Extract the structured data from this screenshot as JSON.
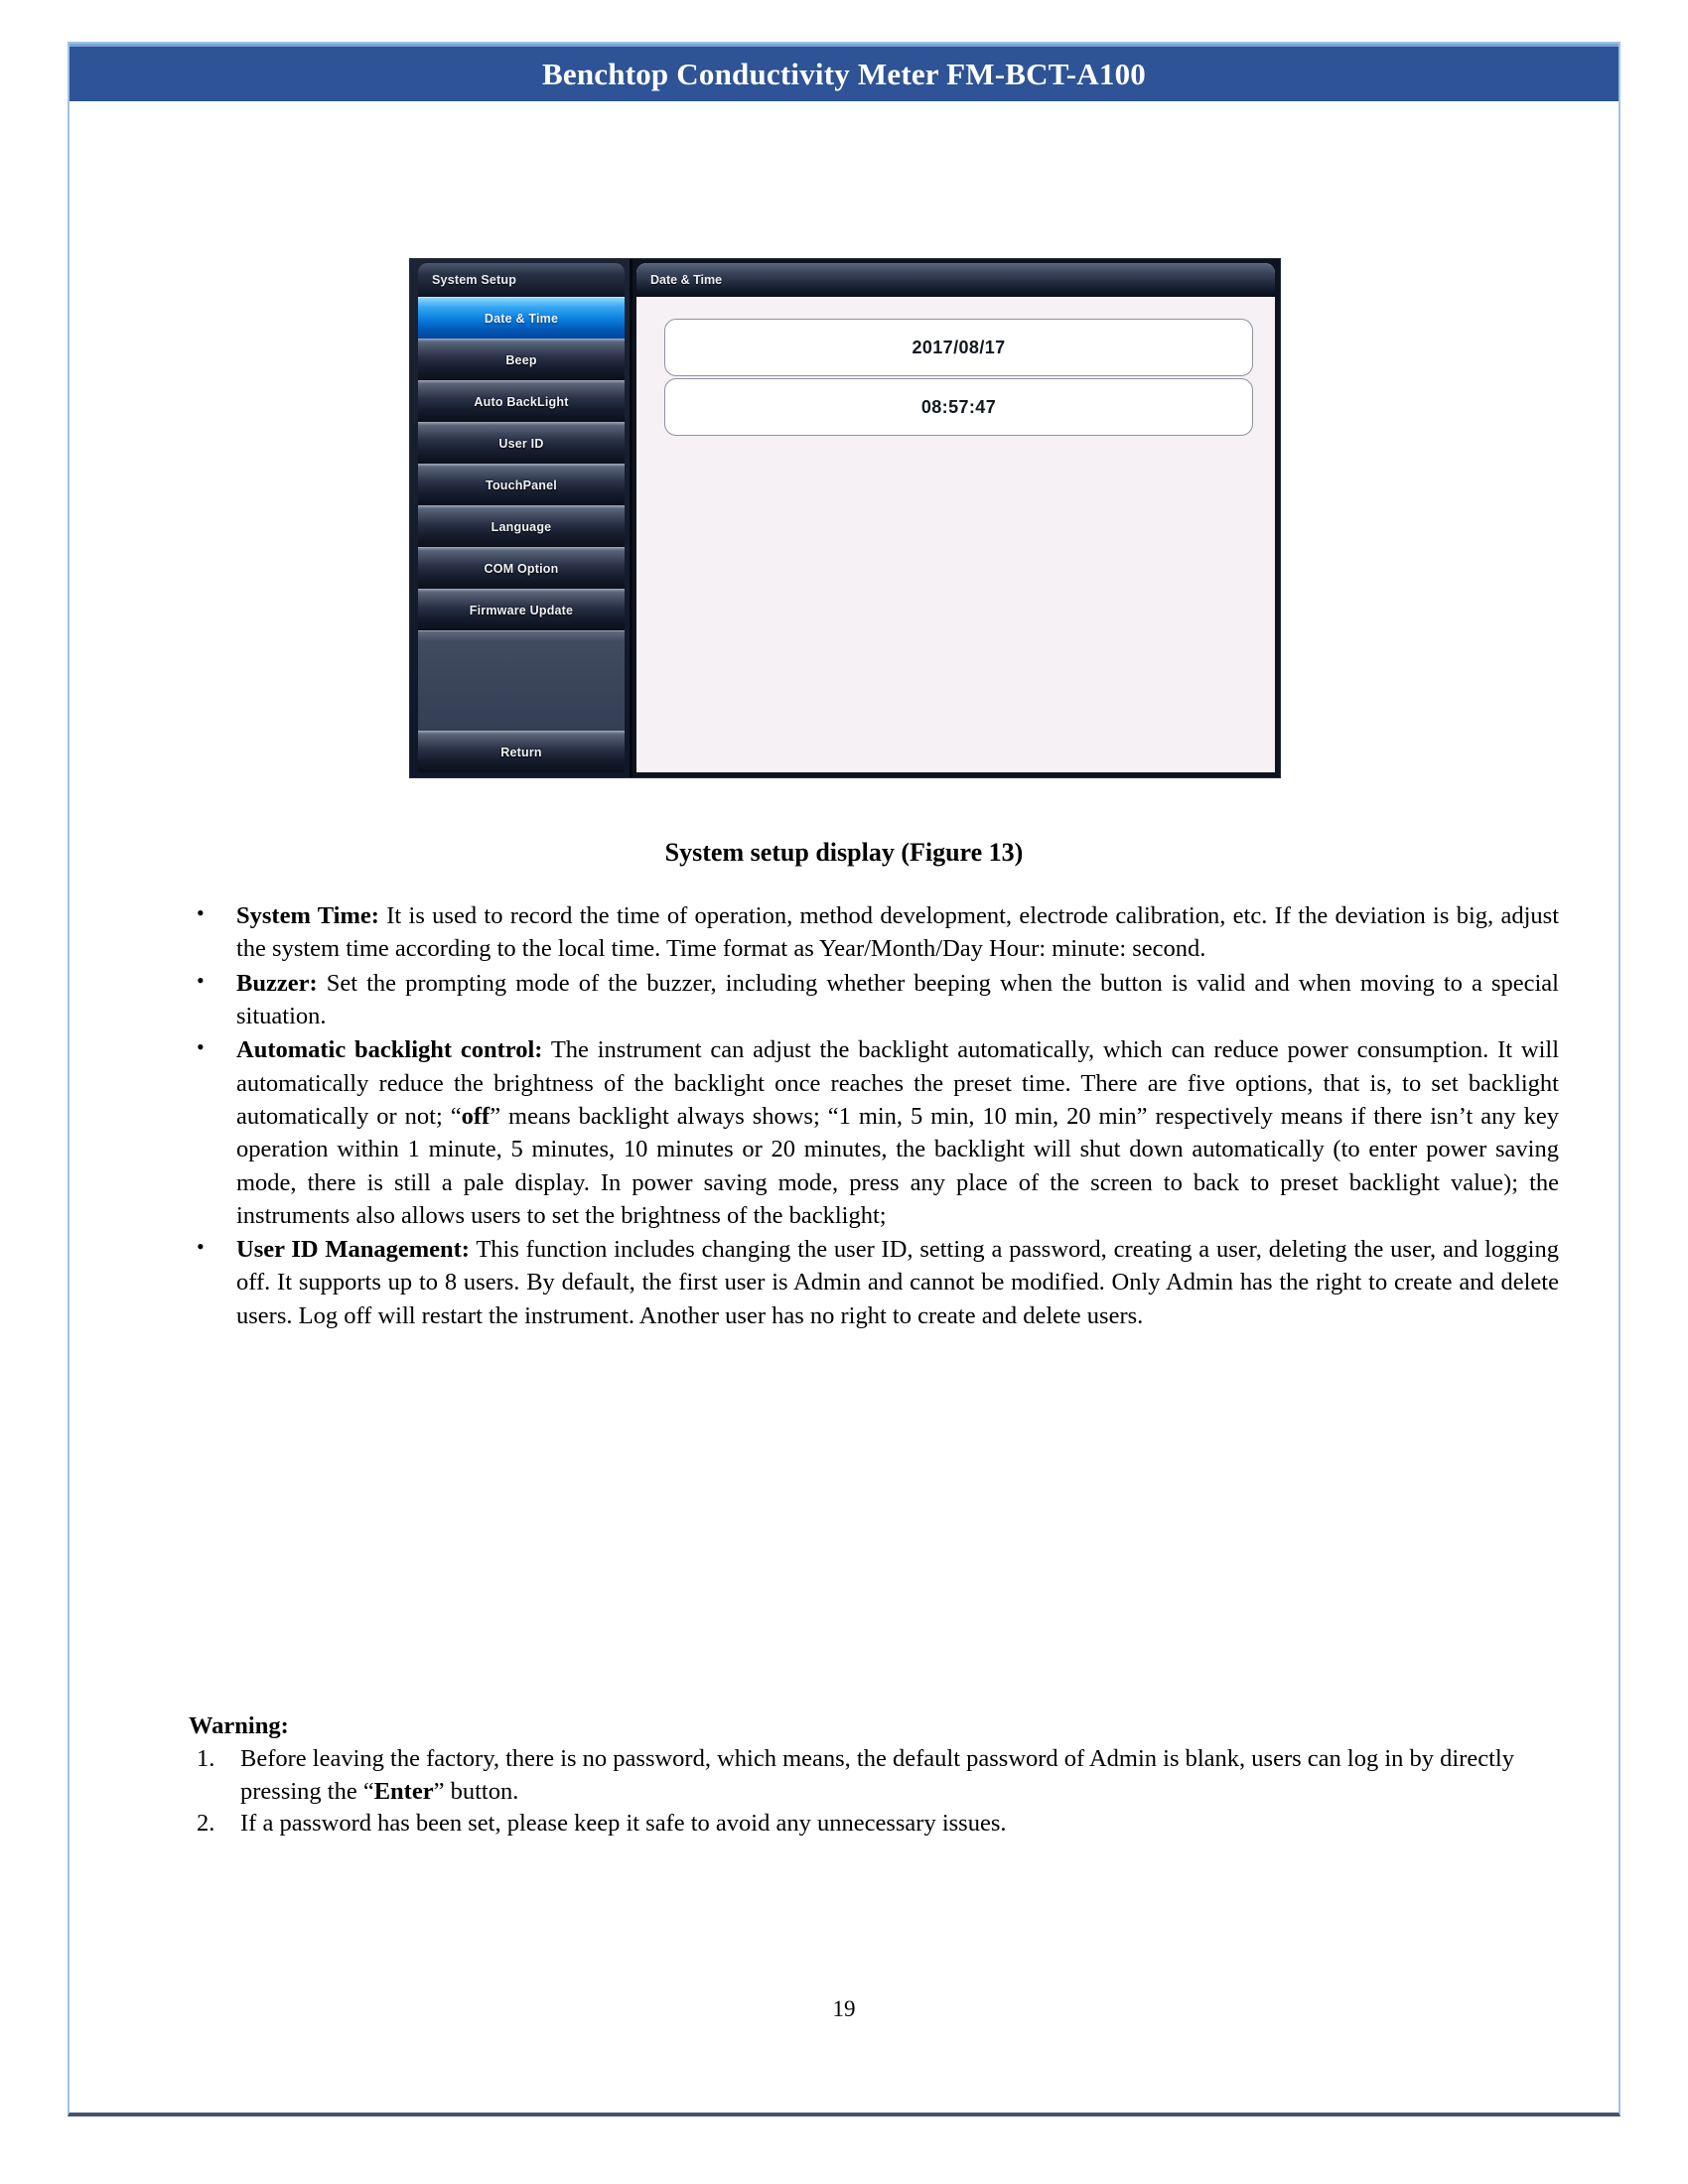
{
  "header": {
    "title": "Benchtop Conductivity Meter FM-BCT-A100",
    "band_color": "#2e5396",
    "band_top_accent": "#7ba3d6"
  },
  "page_border": {
    "side_color": "#9dc3e6",
    "bottom_color": "#44546a"
  },
  "device_screenshot": {
    "sidebar": {
      "title": "System Setup",
      "items": [
        {
          "label": "Date & Time",
          "selected": true
        },
        {
          "label": "Beep",
          "selected": false
        },
        {
          "label": "Auto BackLight",
          "selected": false
        },
        {
          "label": "User ID",
          "selected": false
        },
        {
          "label": "TouchPanel",
          "selected": false
        },
        {
          "label": "Language",
          "selected": false
        },
        {
          "label": "COM Option",
          "selected": false
        },
        {
          "label": "Firmware Update",
          "selected": false
        }
      ],
      "return_label": "Return",
      "highlight_color": "#0a7fe0"
    },
    "main_panel": {
      "title": "Date & Time",
      "date_value": "2017/08/17",
      "time_value": "08:57:47"
    }
  },
  "figure_caption": "System setup display (Figure 13)",
  "bullets": [
    {
      "lead": "System Time:",
      "text": " It is used to record the time of operation, method development, electrode calibration, etc. If the deviation is big, adjust the system time according to the local time. Time format as Year/Month/Day Hour: minute: second."
    },
    {
      "lead": "Buzzer:",
      "text": " Set the prompting mode of the buzzer, including whether beeping when the button is valid and when moving to a special situation."
    },
    {
      "lead": "Automatic backlight control:",
      "part1": " The instrument can adjust the backlight automatically, which can reduce power consumption. It will automatically reduce the brightness of the backlight once reaches the preset time. There are five options, that is, to set backlight automatically or not; “",
      "emphasis": "off",
      "part2": "” means backlight always shows; “1 min, 5 min, 10 min, 20 min” respectively means if there isn’t any key operation within 1 minute, 5 minutes, 10 minutes or 20 minutes, the backlight will shut down automatically (to enter power saving mode, there is still a pale display. In power saving mode, press any place of the screen to back to preset backlight value); the instruments also allows users to set the brightness of the backlight;"
    },
    {
      "lead": "User ID Management:",
      "text": " This function includes changing the user ID, setting a password, creating a user, deleting the user, and logging off. It supports up to 8 users. By default, the first user is Admin and cannot be modified. Only Admin has the right to create and delete users. Log off will restart the instrument. Another user has no right to create and delete users."
    }
  ],
  "warning": {
    "title": "Warning:",
    "items": [
      {
        "part1": "Before leaving the factory, there is no password, which means, the default password of Admin is blank, users can log in by directly pressing the “",
        "emphasis": "Enter",
        "part2": "” button."
      },
      {
        "part1": "If a password has been set, please keep it safe to avoid any unnecessary issues.",
        "emphasis": "",
        "part2": ""
      }
    ]
  },
  "page_number": "19"
}
